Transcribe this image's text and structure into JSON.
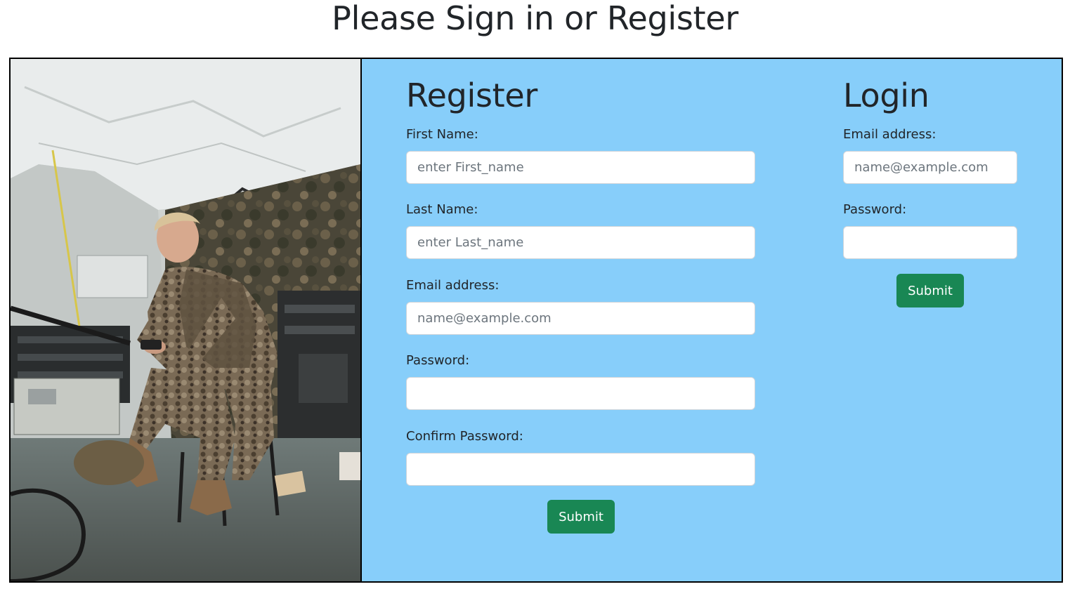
{
  "page": {
    "title": "Please Sign in or Register"
  },
  "photo": {
    "icon": "photo-soldier-in-tent"
  },
  "register": {
    "heading": "Register",
    "first_name": {
      "label": "First Name:",
      "placeholder": "enter First_name",
      "value": ""
    },
    "last_name": {
      "label": "Last Name:",
      "placeholder": "enter Last_name",
      "value": ""
    },
    "email": {
      "label": "Email address:",
      "placeholder": "name@example.com",
      "value": ""
    },
    "password": {
      "label": "Password:",
      "placeholder": "",
      "value": ""
    },
    "confirm_password": {
      "label": "Confirm Password:",
      "placeholder": "",
      "value": ""
    },
    "submit_label": "Submit"
  },
  "login": {
    "heading": "Login",
    "email": {
      "label": "Email address:",
      "placeholder": "name@example.com",
      "value": ""
    },
    "password": {
      "label": "Password:",
      "placeholder": "",
      "value": ""
    },
    "submit_label": "Submit"
  },
  "colors": {
    "panel_background": "#87cefa",
    "button_green": "#198754",
    "text": "#212529",
    "border": "#000000"
  }
}
